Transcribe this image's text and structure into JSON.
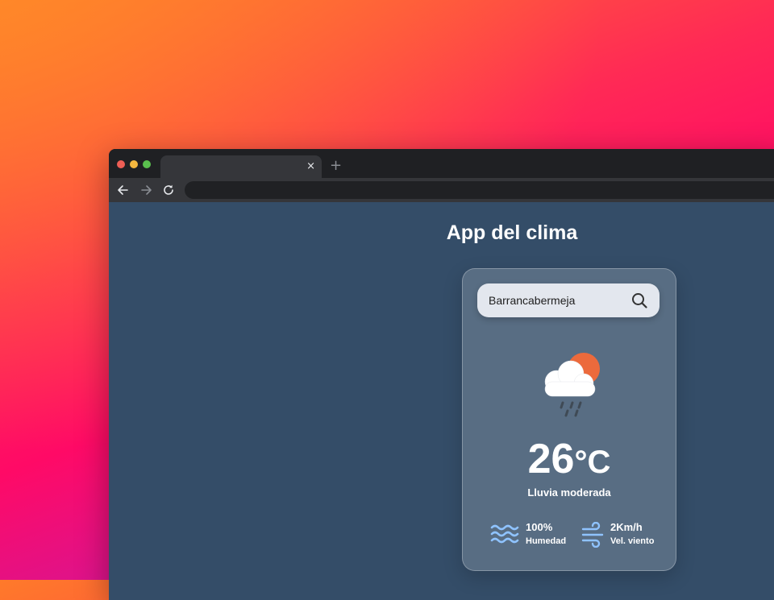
{
  "browser": {
    "tab_close_glyph": "×",
    "new_tab_glyph": "+",
    "omnibox_value": ""
  },
  "app": {
    "title": "App del clima",
    "search": {
      "value": "Barrancabermeja",
      "placeholder": ""
    },
    "weather_icon": "cloud-sun-rain-icon",
    "temperature": {
      "value": "26",
      "unit": "°C"
    },
    "description": "Lluvia moderada",
    "humidity": {
      "value": "100%",
      "label": "Humedad",
      "icon": "waves-icon"
    },
    "wind": {
      "value": "2Km/h",
      "label": "Vel. viento",
      "icon": "wind-icon"
    }
  },
  "colors": {
    "content_bg": "#344d68",
    "sun": "#ec6a3c",
    "detail_icon": "#8fc3ff"
  }
}
